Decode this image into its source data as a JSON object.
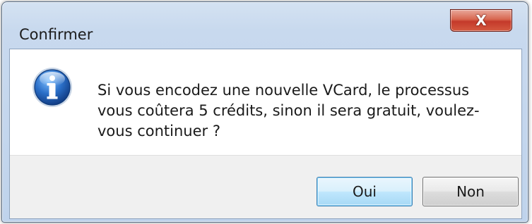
{
  "window": {
    "title": "Confirmer",
    "close_glyph": "X"
  },
  "dialog": {
    "icon": "info-icon",
    "message": "Si vous encodez une nouvelle VCard, le processus vous coûtera 5 crédits, sinon il sera gratuit, voulez-vous continuer ?"
  },
  "buttons": {
    "yes_label": "Oui",
    "no_label": "Non"
  },
  "colors": {
    "icon_blue": "#1e63b8",
    "close_red": "#c4392a",
    "default_button_border": "#3c7fb1"
  }
}
